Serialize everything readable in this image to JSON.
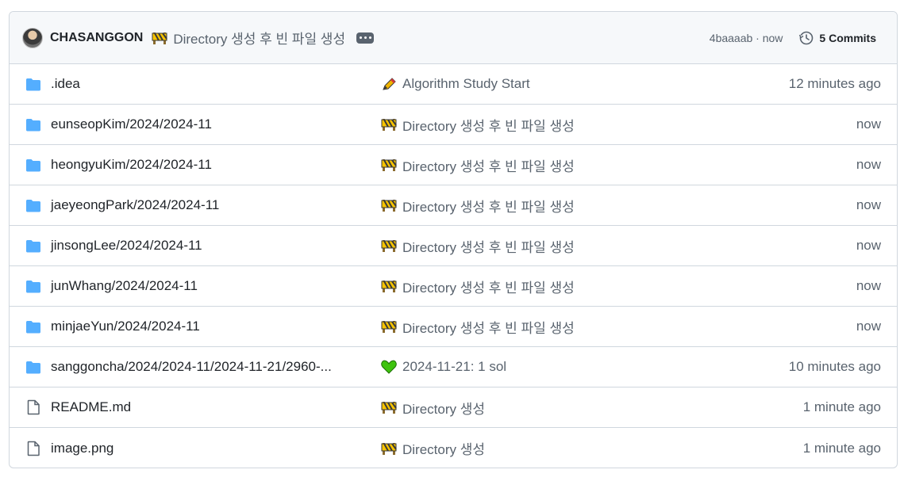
{
  "header": {
    "author": "CHASANGGON",
    "message": "Directory 생성 후 빈 파일 생성",
    "message_icon": "construction-icon",
    "hash": "4baaaab · now",
    "commits_label": "5 Commits"
  },
  "rows": [
    {
      "type": "folder",
      "name": ".idea",
      "icon": "pencil-icon",
      "message": "Algorithm Study Start",
      "time": "12 minutes ago"
    },
    {
      "type": "folder",
      "name": "eunseopKim/2024/2024-11",
      "icon": "construction-icon",
      "message": "Directory 생성 후 빈 파일 생성",
      "time": "now"
    },
    {
      "type": "folder",
      "name": "heongyuKim/2024/2024-11",
      "icon": "construction-icon",
      "message": "Directory 생성 후 빈 파일 생성",
      "time": "now"
    },
    {
      "type": "folder",
      "name": "jaeyeongPark/2024/2024-11",
      "icon": "construction-icon",
      "message": "Directory 생성 후 빈 파일 생성",
      "time": "now"
    },
    {
      "type": "folder",
      "name": "jinsongLee/2024/2024-11",
      "icon": "construction-icon",
      "message": "Directory 생성 후 빈 파일 생성",
      "time": "now"
    },
    {
      "type": "folder",
      "name": "junWhang/2024/2024-11",
      "icon": "construction-icon",
      "message": "Directory 생성 후 빈 파일 생성",
      "time": "now"
    },
    {
      "type": "folder",
      "name": "minjaeYun/2024/2024-11",
      "icon": "construction-icon",
      "message": "Directory 생성 후 빈 파일 생성",
      "time": "now"
    },
    {
      "type": "folder",
      "name": "sanggoncha/2024/2024-11/2024-11-21/2960-...",
      "icon": "green-heart-icon",
      "message": "2024-11-21: 1 sol",
      "time": "10 minutes ago"
    },
    {
      "type": "file",
      "name": "README.md",
      "icon": "construction-icon",
      "message": "Directory 생성",
      "time": "1 minute ago"
    },
    {
      "type": "file",
      "name": "image.png",
      "icon": "construction-icon",
      "message": "Directory 생성",
      "time": "1 minute ago"
    }
  ],
  "colors": {
    "folder": "#54aeff",
    "border": "#d0d7de",
    "muted": "#59636e",
    "text": "#1f2328"
  }
}
